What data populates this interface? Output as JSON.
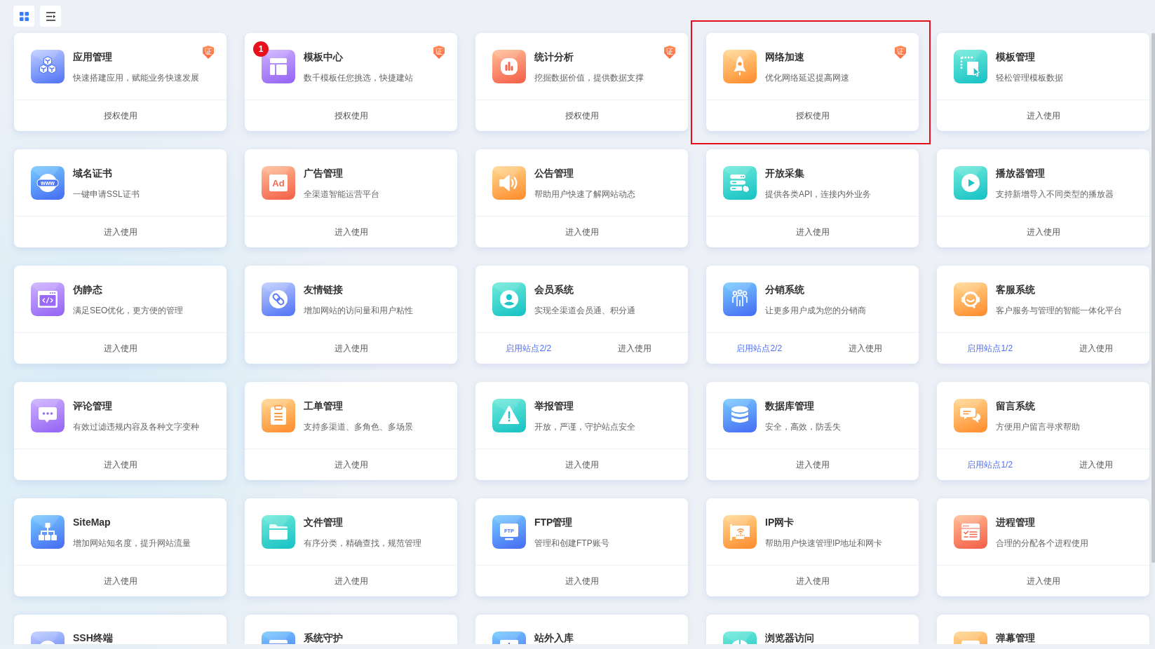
{
  "toolbar": {
    "views": [
      {
        "kind": "grid",
        "selected": true
      },
      {
        "kind": "list",
        "selected": false
      }
    ]
  },
  "cards": [
    {
      "title": "应用管理",
      "description": "快速搭建应用，赋能业务快速发展",
      "badge": "证",
      "highlighted": false,
      "actions": [
        {
          "kind": "action",
          "label": "授权使用"
        }
      ]
    },
    {
      "title": "模板中心",
      "description": "数千模板任您挑选，快捷建站",
      "badge": "证",
      "notification": "1",
      "highlighted": false,
      "actions": [
        {
          "kind": "action",
          "label": "授权使用"
        }
      ]
    },
    {
      "title": "统计分析",
      "description": "挖掘数据价值，提供数据支撑",
      "badge": "证",
      "highlighted": false,
      "actions": [
        {
          "kind": "action",
          "label": "授权使用"
        }
      ]
    },
    {
      "title": "网络加速",
      "description": "优化网络延迟提高网速",
      "badge": "证",
      "highlighted": true,
      "actions": [
        {
          "kind": "action",
          "label": "授权使用"
        }
      ]
    },
    {
      "title": "模板管理",
      "description": "轻松管理模板数据",
      "highlighted": false,
      "actions": [
        {
          "kind": "action",
          "label": "进入使用"
        }
      ]
    },
    {
      "title": "域名证书",
      "description": "一键申请SSL证书",
      "icon_text": "www",
      "highlighted": false,
      "actions": [
        {
          "kind": "action",
          "label": "进入使用"
        }
      ]
    },
    {
      "title": "广告管理",
      "description": "全渠道智能运营平台",
      "icon_text": "Ad",
      "highlighted": false,
      "actions": [
        {
          "kind": "action",
          "label": "进入使用"
        }
      ]
    },
    {
      "title": "公告管理",
      "description": "帮助用户快速了解网站动态",
      "highlighted": false,
      "actions": [
        {
          "kind": "action",
          "label": "进入使用"
        }
      ]
    },
    {
      "title": "开放采集",
      "description": "提供各类API，连接内外业务",
      "highlighted": false,
      "actions": [
        {
          "kind": "action",
          "label": "进入使用"
        }
      ]
    },
    {
      "title": "播放器管理",
      "description": "支持新增导入不同类型的播放器",
      "highlighted": false,
      "actions": [
        {
          "kind": "action",
          "label": "进入使用"
        }
      ]
    },
    {
      "title": "伪静态",
      "description": "满足SEO优化，更方便的管理",
      "highlighted": false,
      "actions": [
        {
          "kind": "action",
          "label": "进入使用"
        }
      ]
    },
    {
      "title": "友情链接",
      "description": "增加网站的访问量和用户粘性",
      "highlighted": false,
      "actions": [
        {
          "kind": "action",
          "label": "进入使用"
        }
      ]
    },
    {
      "title": "会员系统",
      "description": "实现全渠道会员通、积分通",
      "highlighted": false,
      "actions": [
        {
          "kind": "sites",
          "label": "启用站点2/2"
        },
        {
          "kind": "action",
          "label": "进入使用"
        }
      ]
    },
    {
      "title": "分销系统",
      "description": "让更多用户成为您的分销商",
      "highlighted": false,
      "actions": [
        {
          "kind": "sites",
          "label": "启用站点2/2"
        },
        {
          "kind": "action",
          "label": "进入使用"
        }
      ]
    },
    {
      "title": "客服系统",
      "description": "客户服务与管理的智能一体化平台",
      "highlighted": false,
      "actions": [
        {
          "kind": "sites",
          "label": "启用站点1/2"
        },
        {
          "kind": "action",
          "label": "进入使用"
        }
      ]
    },
    {
      "title": "评论管理",
      "description": "有效过滤违规内容及各种文字变种",
      "highlighted": false,
      "actions": [
        {
          "kind": "action",
          "label": "进入使用"
        }
      ]
    },
    {
      "title": "工单管理",
      "description": "支持多渠道、多角色、多场景",
      "highlighted": false,
      "actions": [
        {
          "kind": "action",
          "label": "进入使用"
        }
      ]
    },
    {
      "title": "举报管理",
      "description": "开放，严谨，守护站点安全",
      "highlighted": false,
      "actions": [
        {
          "kind": "action",
          "label": "进入使用"
        }
      ]
    },
    {
      "title": "数据库管理",
      "description": "安全，高效，防丢失",
      "highlighted": false,
      "actions": [
        {
          "kind": "action",
          "label": "进入使用"
        }
      ]
    },
    {
      "title": "留言系统",
      "description": "方便用户留言寻求帮助",
      "highlighted": false,
      "actions": [
        {
          "kind": "sites",
          "label": "启用站点1/2"
        },
        {
          "kind": "action",
          "label": "进入使用"
        }
      ]
    },
    {
      "title": "SiteMap",
      "description": "增加网站知名度，提升网站流量",
      "highlighted": false,
      "actions": [
        {
          "kind": "action",
          "label": "进入使用"
        }
      ]
    },
    {
      "title": "文件管理",
      "description": "有序分类，精确查找，规范管理",
      "highlighted": false,
      "actions": [
        {
          "kind": "action",
          "label": "进入使用"
        }
      ]
    },
    {
      "title": "FTP管理",
      "description": "管理和创建FTP账号",
      "icon_text": "FTP",
      "highlighted": false,
      "actions": [
        {
          "kind": "action",
          "label": "进入使用"
        }
      ]
    },
    {
      "title": "IP网卡",
      "description": "帮助用户快速管理IP地址和网卡",
      "highlighted": false,
      "actions": [
        {
          "kind": "action",
          "label": "进入使用"
        }
      ]
    },
    {
      "title": "进程管理",
      "description": "合理的分配各个进程使用",
      "highlighted": false,
      "actions": [
        {
          "kind": "action",
          "label": "进入使用"
        }
      ]
    },
    {
      "title": "SSH终端",
      "highlighted": false
    },
    {
      "title": "系统守护",
      "highlighted": false
    },
    {
      "title": "站外入库",
      "highlighted": false
    },
    {
      "title": "浏览器访问",
      "highlighted": false
    },
    {
      "title": "弹幕管理",
      "highlighted": false
    }
  ]
}
